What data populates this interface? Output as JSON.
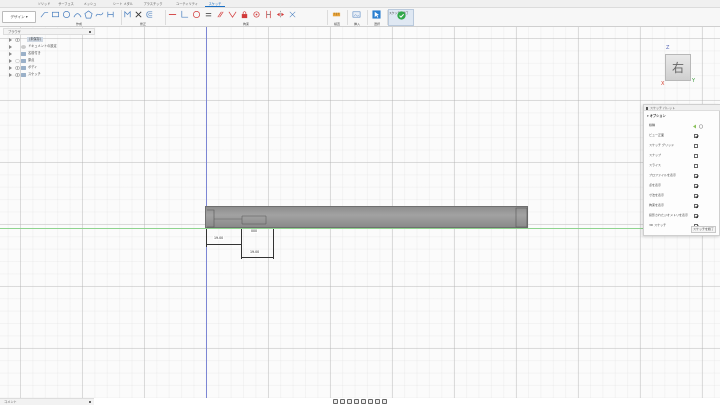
{
  "tabs": [
    "ソリッド",
    "サーフェス",
    "メッシュ",
    "シート メタル",
    "プラスチック",
    "ユーティリティ",
    "スケッチ"
  ],
  "active_tab_index": 6,
  "toolbar": {
    "workspace_label": "デザイン",
    "groups": [
      "作成",
      "修正",
      "拘束",
      "検査",
      "挿入",
      "選択",
      "スケッチを終了"
    ],
    "finish_label": "スケッチを終了",
    "icons": [
      "line-icon",
      "rectangle-icon",
      "circle-icon",
      "arc-icon",
      "polygon-icon",
      "spline-icon",
      "slot-icon",
      "text-icon",
      "trim-icon",
      "offset-icon",
      "constraint-horizontal-icon",
      "constraint-perpendicular-icon",
      "constraint-circle-icon",
      "equal-icon",
      "parallel-icon",
      "collinear-icon",
      "lock-icon",
      "tangent-icon",
      "midpoint-icon",
      "symmetry-icon",
      "fix-icon",
      "measure-icon",
      "insert-image-icon",
      "select-icon",
      "check-icon"
    ]
  },
  "browser": {
    "title": "ブラウザ",
    "items": [
      {
        "label": "(未保存)",
        "root": true
      },
      {
        "label": "ドキュメントの設定"
      },
      {
        "label": "名前付き"
      },
      {
        "label": "原点"
      },
      {
        "label": "ボディ"
      },
      {
        "label": "スケッチ"
      }
    ]
  },
  "viewcube": {
    "face": "右",
    "z": "Z",
    "x": "X",
    "y": "Y"
  },
  "palette": {
    "title": "スケッチ パレット",
    "section": "オプション",
    "rows": [
      {
        "label": "線種",
        "checked": false,
        "kind": "linetype"
      },
      {
        "label": "ビュー正面",
        "checked": true
      },
      {
        "label": "スケッチ グリッド",
        "checked": false
      },
      {
        "label": "スナップ",
        "checked": false
      },
      {
        "label": "スライス",
        "checked": false
      },
      {
        "label": "プロファイルを表示",
        "checked": true
      },
      {
        "label": "点を表示",
        "checked": true
      },
      {
        "label": "寸法を表示",
        "checked": true
      },
      {
        "label": "拘束を表示",
        "checked": true
      },
      {
        "label": "投影されたジオメトリを表示",
        "checked": true
      },
      {
        "label": "3D スケッチ",
        "checked": true
      }
    ],
    "finish_label": "スケッチを終了"
  },
  "sketch": {
    "dim1": "19.00",
    "dim2": "19.00",
    "small_label": "000"
  },
  "comments": {
    "title": "コメント"
  },
  "colors": {
    "accent": "#1a6fc4",
    "finish_green": "#31a84a",
    "lock_red": "#d23a3a",
    "axis_blue": "#7c86d4",
    "axis_green": "#8fd48f"
  }
}
